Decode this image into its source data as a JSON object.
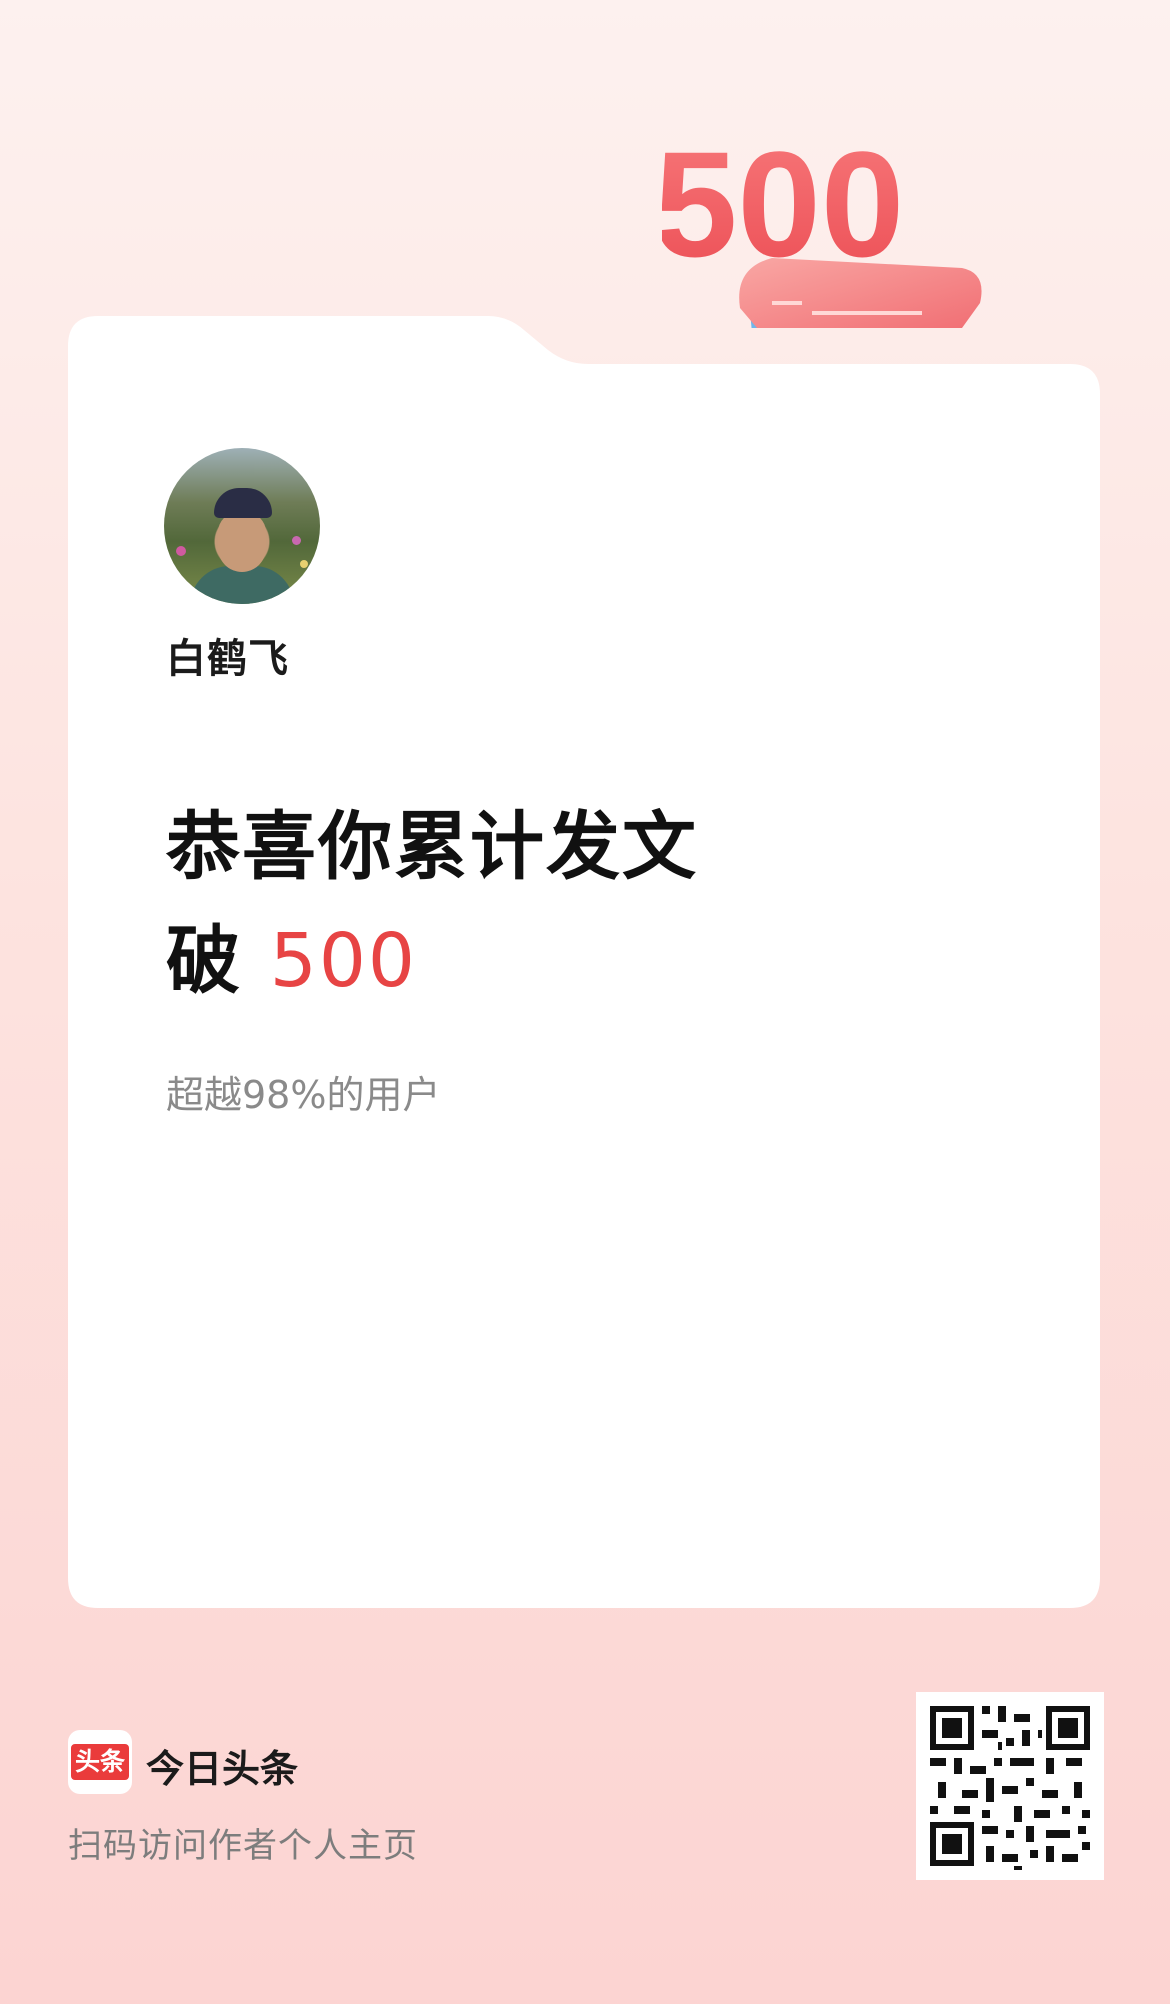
{
  "banner": {
    "big_number": "500"
  },
  "author": {
    "name": "白鹤飞"
  },
  "message": {
    "line1": "恭喜你累计发文",
    "line2_prefix": "破",
    "line2_number": "500",
    "rank": "超越98%的用户"
  },
  "footer": {
    "logo_text": "头条",
    "app_name": "今日头条",
    "scan_hint": "扫码访问作者个人主页"
  },
  "colors": {
    "accent": "#e74444",
    "brand": "#ea3b3b"
  }
}
